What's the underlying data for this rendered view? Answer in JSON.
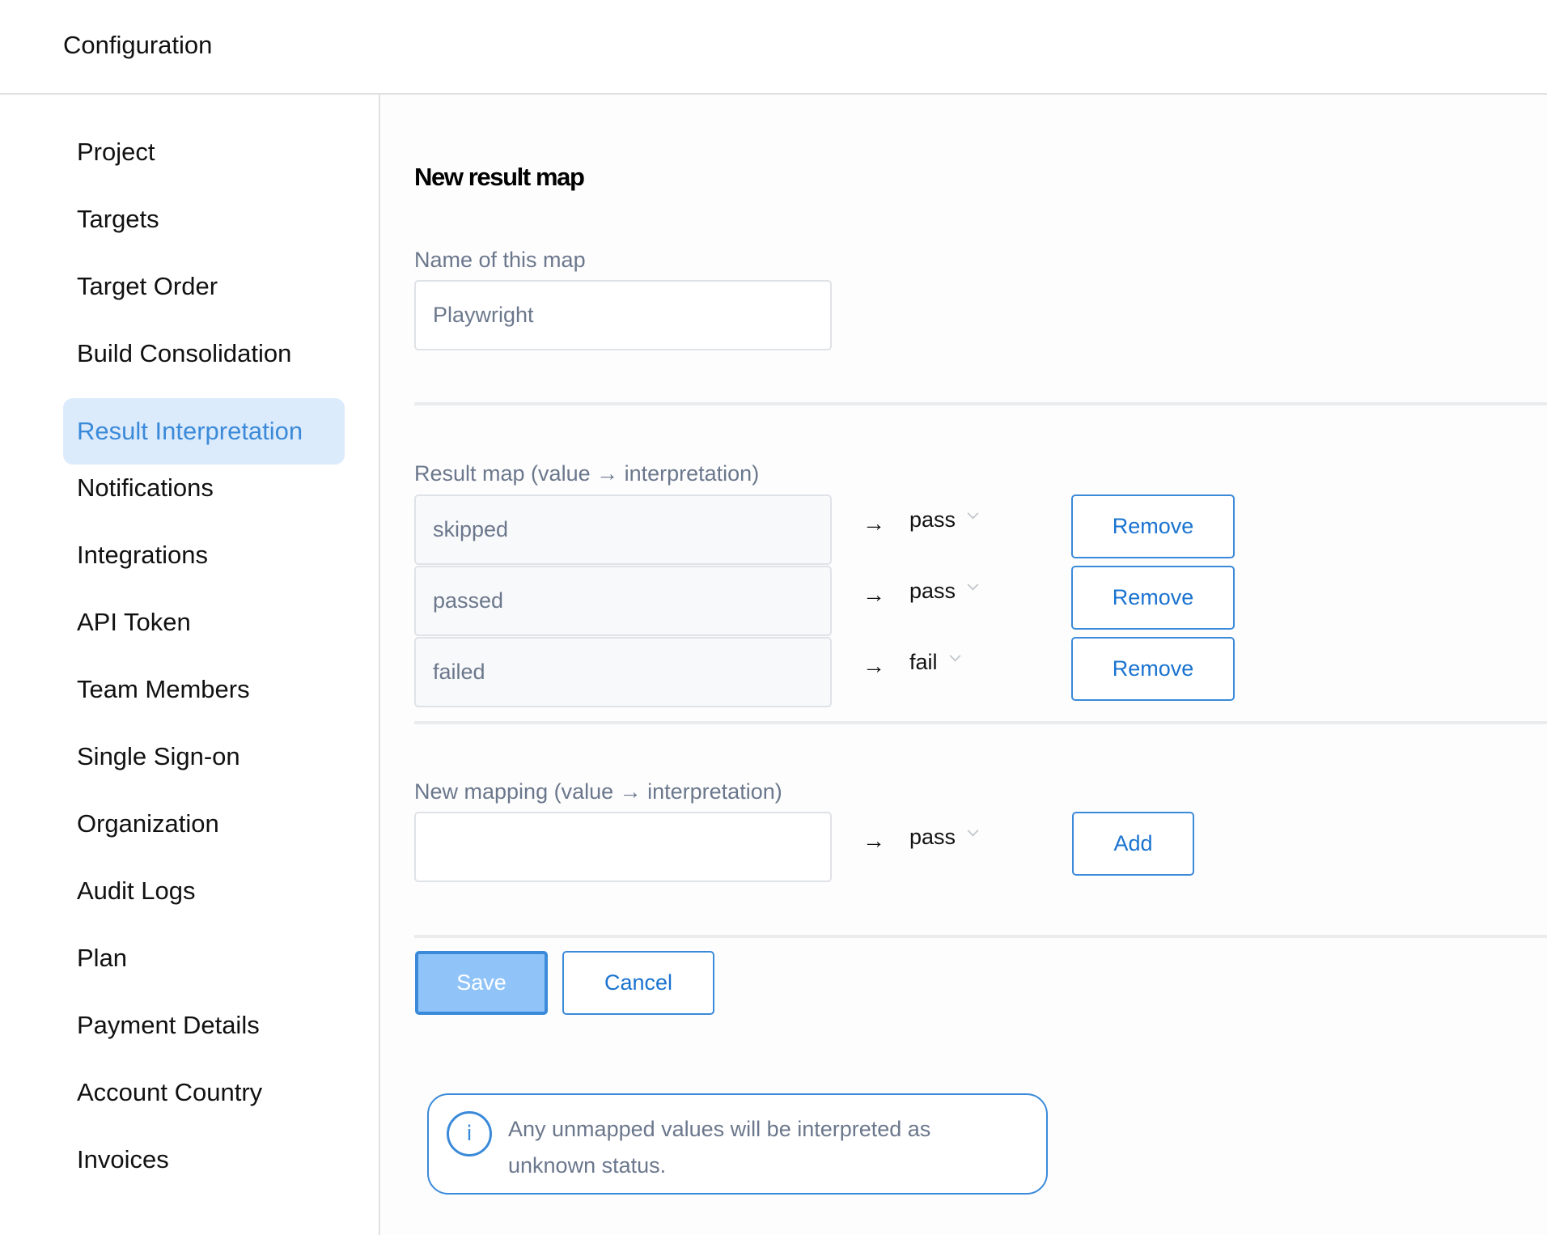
{
  "header": {
    "title": "Configuration"
  },
  "sidebar": {
    "items": [
      {
        "label": "Project",
        "active": false
      },
      {
        "label": "Targets",
        "active": false
      },
      {
        "label": "Target Order",
        "active": false
      },
      {
        "label": "Build Consolidation",
        "active": false
      },
      {
        "label": "Result Interpretation",
        "active": true
      },
      {
        "label": "Notifications",
        "active": false
      },
      {
        "label": "Integrations",
        "active": false
      },
      {
        "label": "API Token",
        "active": false
      },
      {
        "label": "Team Members",
        "active": false
      },
      {
        "label": "Single Sign-on",
        "active": false
      },
      {
        "label": "Organization",
        "active": false
      },
      {
        "label": "Audit Logs",
        "active": false
      },
      {
        "label": "Plan",
        "active": false
      },
      {
        "label": "Payment Details",
        "active": false
      },
      {
        "label": "Account Country",
        "active": false
      },
      {
        "label": "Invoices",
        "active": false
      }
    ]
  },
  "main": {
    "title": "New result map",
    "name_field": {
      "label": "Name of this map",
      "value": "Playwright"
    },
    "result_map": {
      "label": "Result map (value → interpretation)",
      "arrow": "→",
      "rows": [
        {
          "value": "skipped",
          "interpretation": "pass",
          "remove_label": "Remove"
        },
        {
          "value": "passed",
          "interpretation": "pass",
          "remove_label": "Remove"
        },
        {
          "value": "failed",
          "interpretation": "fail",
          "remove_label": "Remove"
        }
      ]
    },
    "new_mapping": {
      "label": "New mapping (value → interpretation)",
      "value": "",
      "placeholder": "",
      "arrow": "→",
      "interpretation": "pass",
      "add_label": "Add"
    },
    "actions": {
      "save_label": "Save",
      "cancel_label": "Cancel"
    },
    "info": {
      "icon": "i",
      "text": "Any unmapped values will be interpreted as unknown status."
    }
  },
  "colors": {
    "accent": "#3b8ad9",
    "button_text": "#1a73d0",
    "active_bg": "#dcebfc",
    "save_bg": "#90c4f9",
    "label_gray": "#6b778c"
  }
}
